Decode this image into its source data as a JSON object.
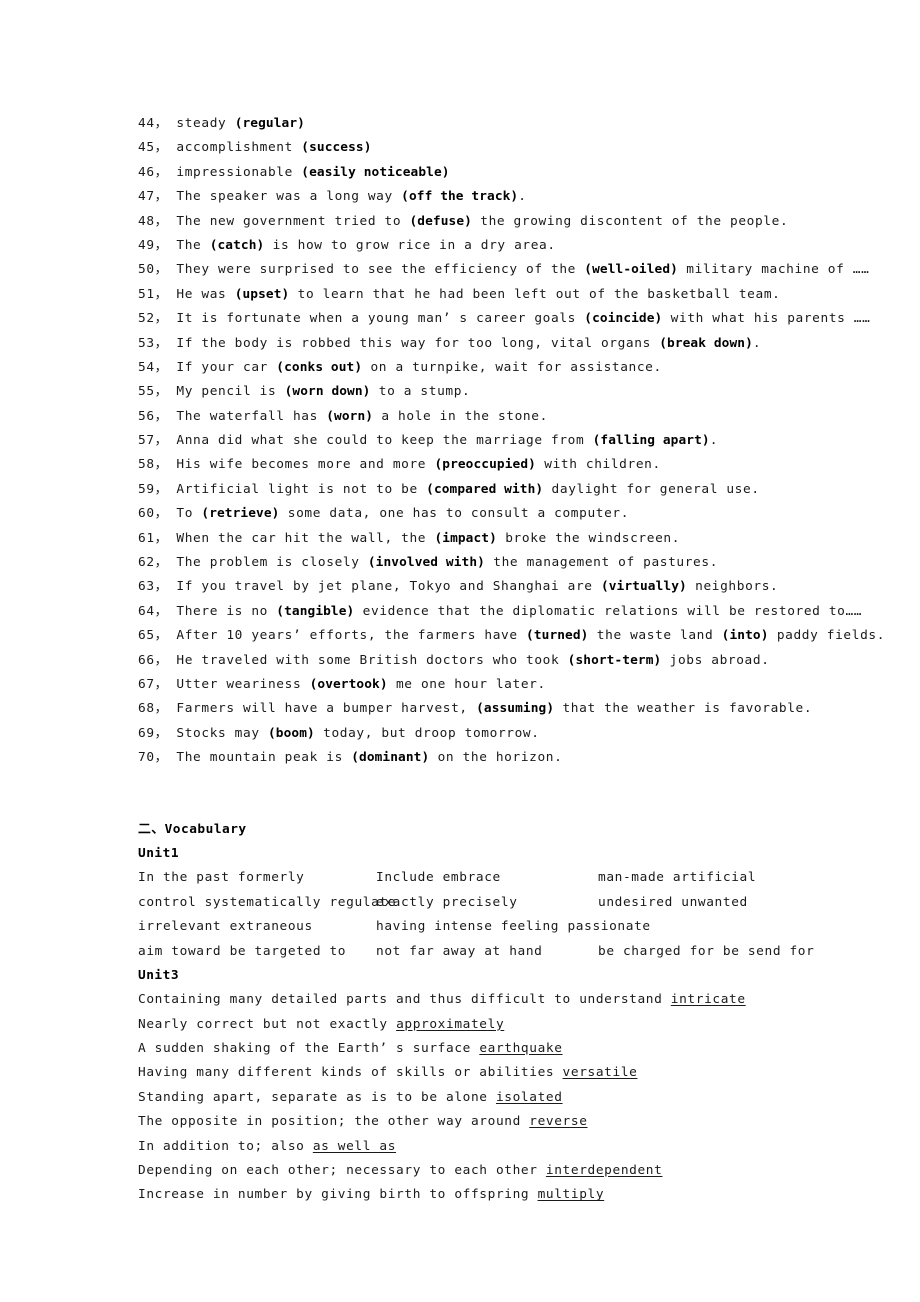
{
  "document": {
    "sentences_section": {
      "items": [
        {
          "num": "44，",
          "pre": "steady ",
          "answer": "(regular)",
          "post": ""
        },
        {
          "num": "45，",
          "pre": "accomplishment ",
          "answer": "(success)",
          "post": ""
        },
        {
          "num": "46，",
          "pre": "impressionable ",
          "answer": "(easily noticeable)",
          "post": ""
        },
        {
          "num": "47，",
          "pre": "The speaker was a long way ",
          "answer": "(off the track)",
          "post": "."
        },
        {
          "num": "48，",
          "pre": "The new government tried to ",
          "answer": "(defuse)",
          "post": " the growing discontent of the people."
        },
        {
          "num": "49，",
          "pre": "The ",
          "answer": "(catch)",
          "post": " is how to grow rice in a dry area."
        },
        {
          "num": "50，",
          "pre": "They were surprised to see the efficiency of the ",
          "answer": "(well-oiled)",
          "post": " military machine of ……"
        },
        {
          "num": "51，",
          "pre": "He was ",
          "answer": "(upset)",
          "post": " to learn that he had been left out of the basketball team."
        },
        {
          "num": "52，",
          "pre": "It is fortunate when a young man’ s career goals ",
          "answer": "(coincide)",
          "post": " with what his parents ……"
        },
        {
          "num": "53，",
          "pre": "If the body is robbed this way for too long, vital organs ",
          "answer": "(break down)",
          "post": "."
        },
        {
          "num": "54，",
          "pre": "If your car ",
          "answer": "(conks out)",
          "post": " on a turnpike, wait for assistance."
        },
        {
          "num": "55，",
          "pre": "My pencil is ",
          "answer": "(worn down)",
          "post": " to a stump."
        },
        {
          "num": "56，",
          "pre": "The waterfall has ",
          "answer": "(worn)",
          "post": " a hole in the stone."
        },
        {
          "num": "57，",
          "pre": "Anna did what she could to keep the marriage from ",
          "answer": "(falling apart)",
          "post": "."
        },
        {
          "num": "58，",
          "pre": "His wife becomes more and more ",
          "answer": "(preoccupied)",
          "post": " with children."
        },
        {
          "num": "59，",
          "pre": "Artificial light is not to be ",
          "answer": "(compared with)",
          "post": " daylight for general use."
        },
        {
          "num": "60，",
          "pre": "To ",
          "answer": "(retrieve)",
          "post": " some data, one has to consult a computer."
        },
        {
          "num": "61，",
          "pre": "When the car hit the wall, the ",
          "answer": "(impact)",
          "post": " broke the windscreen."
        },
        {
          "num": "62，",
          "pre": "The problem is closely ",
          "answer": "(involved with)",
          "post": " the management of pastures."
        },
        {
          "num": "63，",
          "pre": "If you travel by jet plane, Tokyo and Shanghai are ",
          "answer": "(virtually)",
          "post": " neighbors."
        },
        {
          "num": "64，",
          "pre": "There is no ",
          "answer": "(tangible)",
          "post": " evidence that the diplomatic relations will be restored to……"
        },
        {
          "num": "65，",
          "pre": "After 10 years’  efforts, the farmers have ",
          "answer": "(turned)",
          "post": " the waste land ",
          "answer2": "(into)",
          "post2": " paddy fields."
        },
        {
          "num": "66，",
          "pre": "He traveled with some British doctors who took ",
          "answer": "(short-term)",
          "post": " jobs abroad."
        },
        {
          "num": "67，",
          "pre": "Utter weariness ",
          "answer": "(overtook)",
          "post": " me one hour later."
        },
        {
          "num": "68，",
          "pre": "Farmers will have a bumper harvest, ",
          "answer": "(assuming)",
          "post": " that the weather is favorable."
        },
        {
          "num": "69，",
          "pre": "Stocks may ",
          "answer": "(boom)",
          "post": " today, but droop tomorrow."
        },
        {
          "num": "70，",
          "pre": "The mountain peak is ",
          "answer": "(dominant)",
          "post": " on the horizon."
        }
      ]
    },
    "vocabulary_section": {
      "heading": "二、Vocabulary",
      "unit1": {
        "heading": "Unit1",
        "rows": [
          [
            {
              "clue": "In the past ",
              "answer": "formerly"
            },
            {
              "clue": "Include ",
              "answer": "embrace "
            },
            {
              "clue": "man-made ",
              "answer": "artificial"
            }
          ],
          [
            {
              "clue": "control systematically ",
              "answer": "regulate"
            },
            {
              "clue": "exactly ",
              "answer": "precisely"
            },
            {
              "clue": "undesired ",
              "answer": "unwanted"
            }
          ],
          [
            {
              "clue": "irrelevant ",
              "answer": "extraneous"
            },
            {
              "clue": "having intense feeling ",
              "answer": "passionate"
            },
            {
              "clue": "",
              "answer": ""
            }
          ],
          [
            {
              "clue": "aim toward ",
              "answer": "be targeted to"
            },
            {
              "clue": "not far away ",
              "answer": "at hand"
            },
            {
              "clue": "be charged for ",
              "answer": "be send for"
            }
          ]
        ]
      },
      "unit3": {
        "heading": "Unit3",
        "rows": [
          {
            "clue": "Containing many detailed parts and thus difficult to understand ",
            "answer": "intricate"
          },
          {
            "clue": "Nearly correct but not exactly ",
            "answer": "approximately"
          },
          {
            "clue": "A sudden shaking of the Earth’ s surface ",
            "answer": "earthquake"
          },
          {
            "clue": "Having many different kinds of skills or abilities ",
            "answer": "versatile"
          },
          {
            "clue": "Standing apart, separate as is to be alone ",
            "answer": "isolated"
          },
          {
            "clue": "The opposite in position; the other way around ",
            "answer": "reverse"
          },
          {
            "clue": "In addition to; also ",
            "answer": "as well as"
          },
          {
            "clue": "Depending on each other; necessary to each other ",
            "answer": "interdependent"
          },
          {
            "clue": "Increase in number by giving birth to offspring ",
            "answer": "multiply"
          }
        ]
      }
    }
  }
}
